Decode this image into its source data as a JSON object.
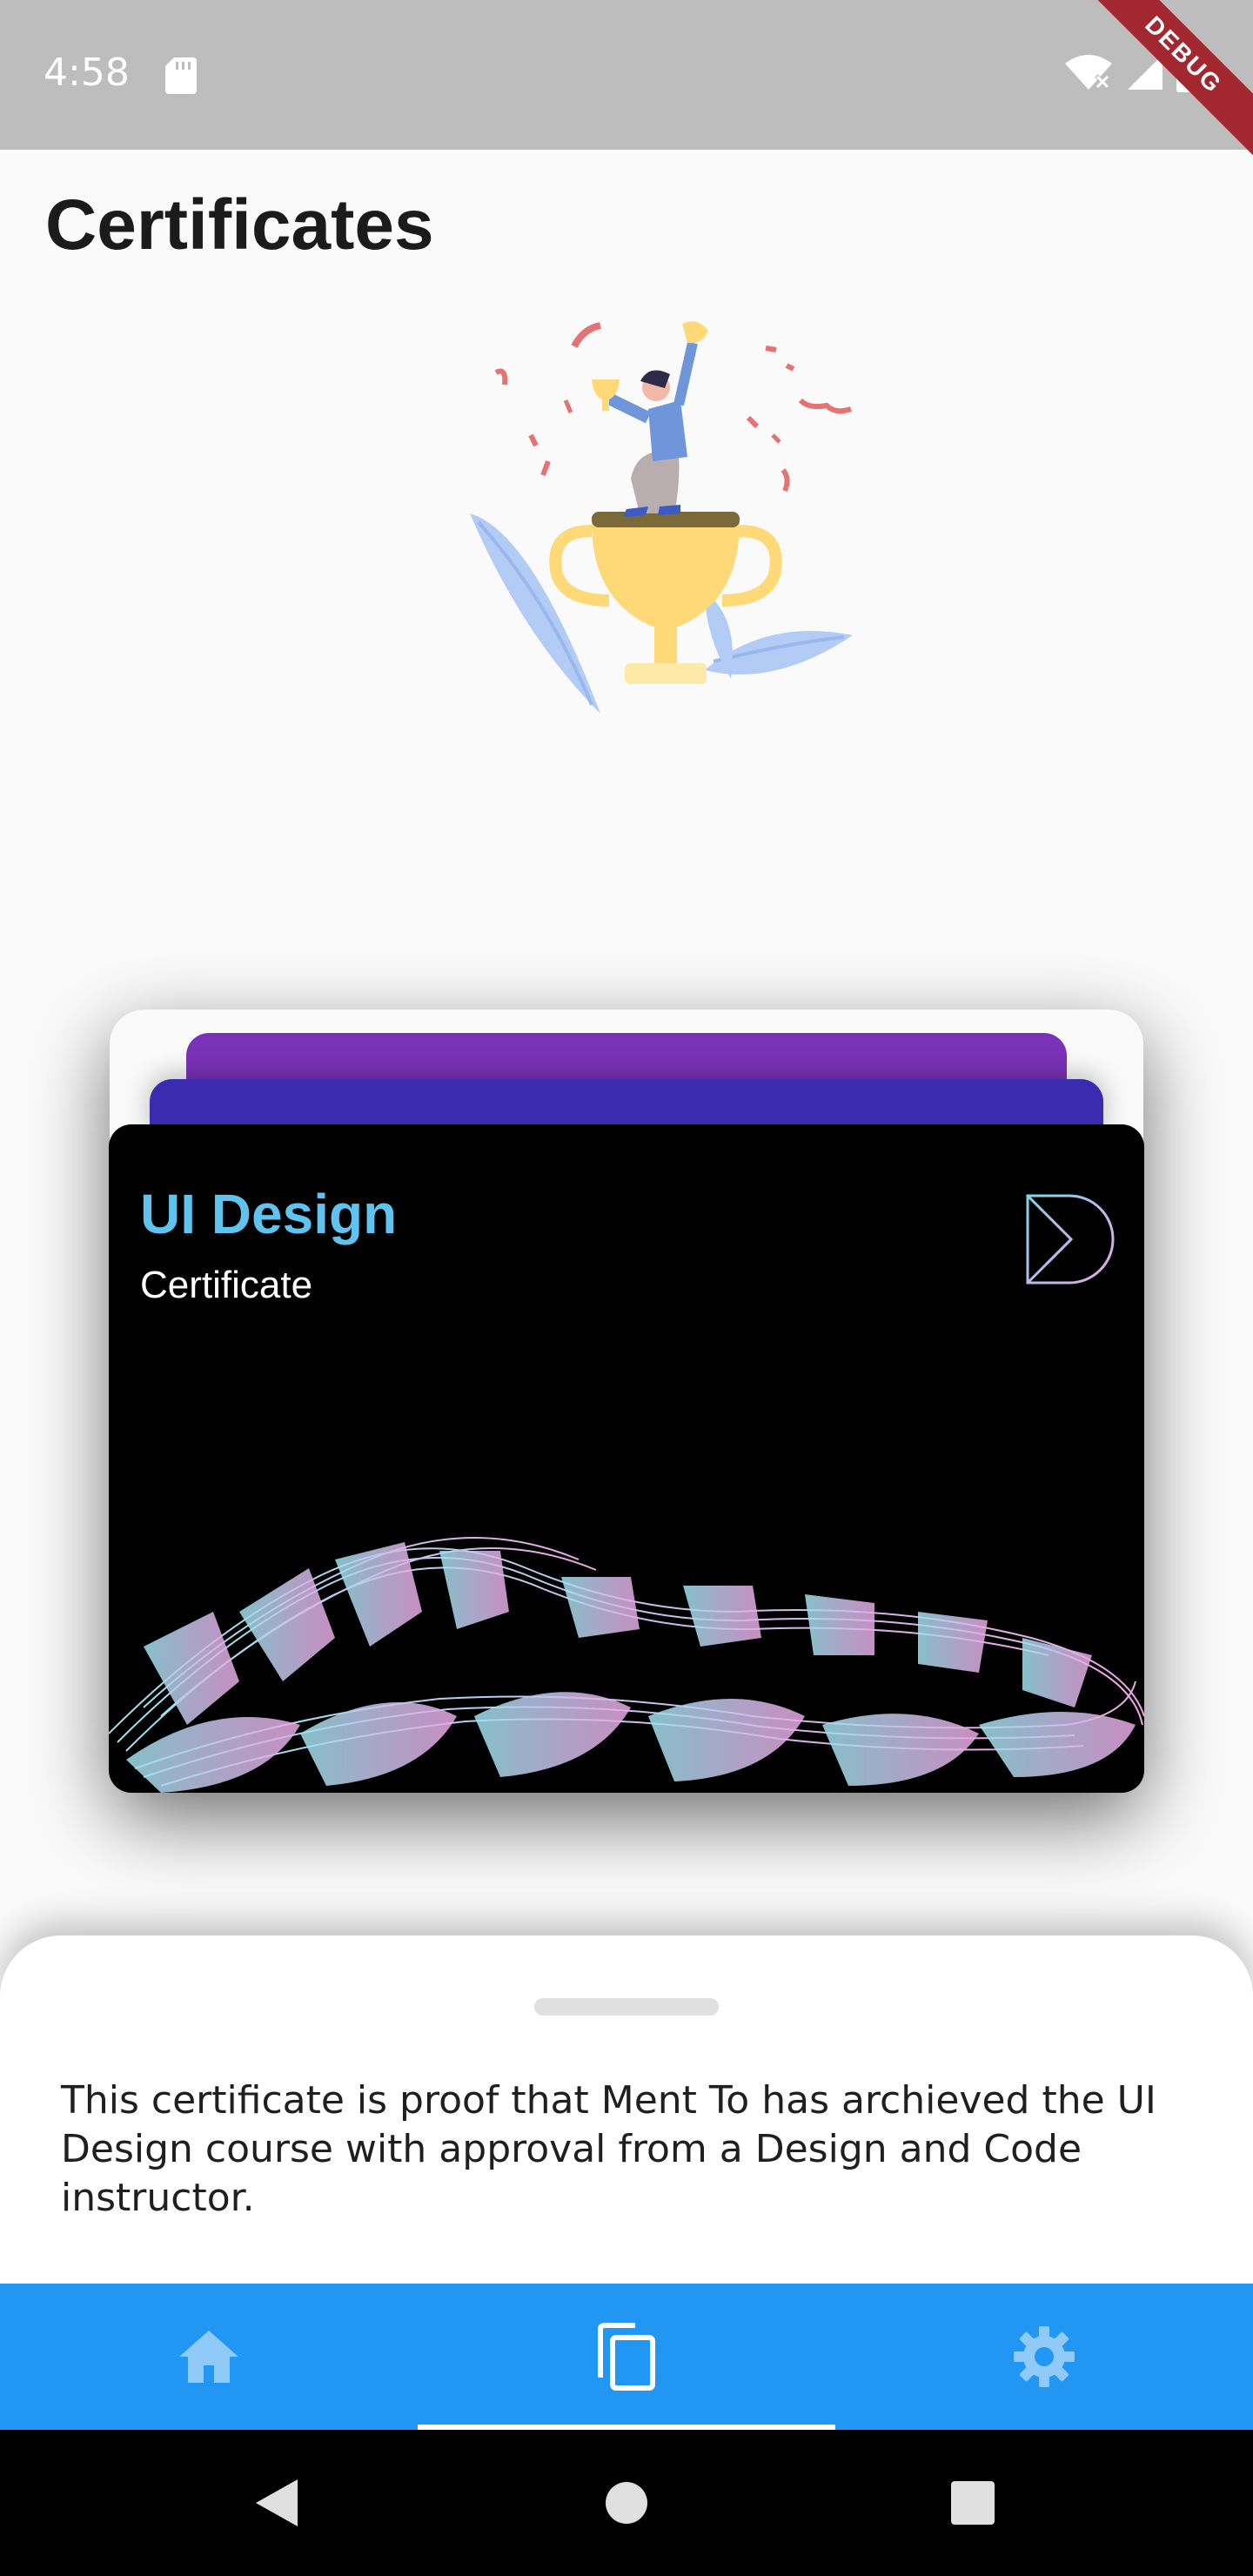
{
  "status_bar": {
    "time": "4:58",
    "debug_label": "DEBUG",
    "icons": [
      "sd-card-icon",
      "wifi-off-icon",
      "signal-icon",
      "battery-icon"
    ]
  },
  "page": {
    "title": "Certificates",
    "illustration": "trophy-celebration-illustration"
  },
  "card": {
    "title": "UI Design",
    "subtitle": "Certificate",
    "logo": "brand-k-logo",
    "title_color": "#5ec4ef",
    "back_colors": [
      "#3a2bb0",
      "#7b32b8"
    ]
  },
  "sheet": {
    "description": "This certificate is proof that Ment To has archieved the UI Design course with approval from a Design and Code instructor."
  },
  "bottom_nav": {
    "background": "#2196f3",
    "tabs": [
      {
        "icon": "home-icon",
        "selected": false
      },
      {
        "icon": "copy-icon",
        "selected": true
      },
      {
        "icon": "gear-icon",
        "selected": false
      }
    ]
  },
  "system_nav": {
    "buttons": [
      "back-icon",
      "home-circle-icon",
      "recents-icon"
    ]
  }
}
